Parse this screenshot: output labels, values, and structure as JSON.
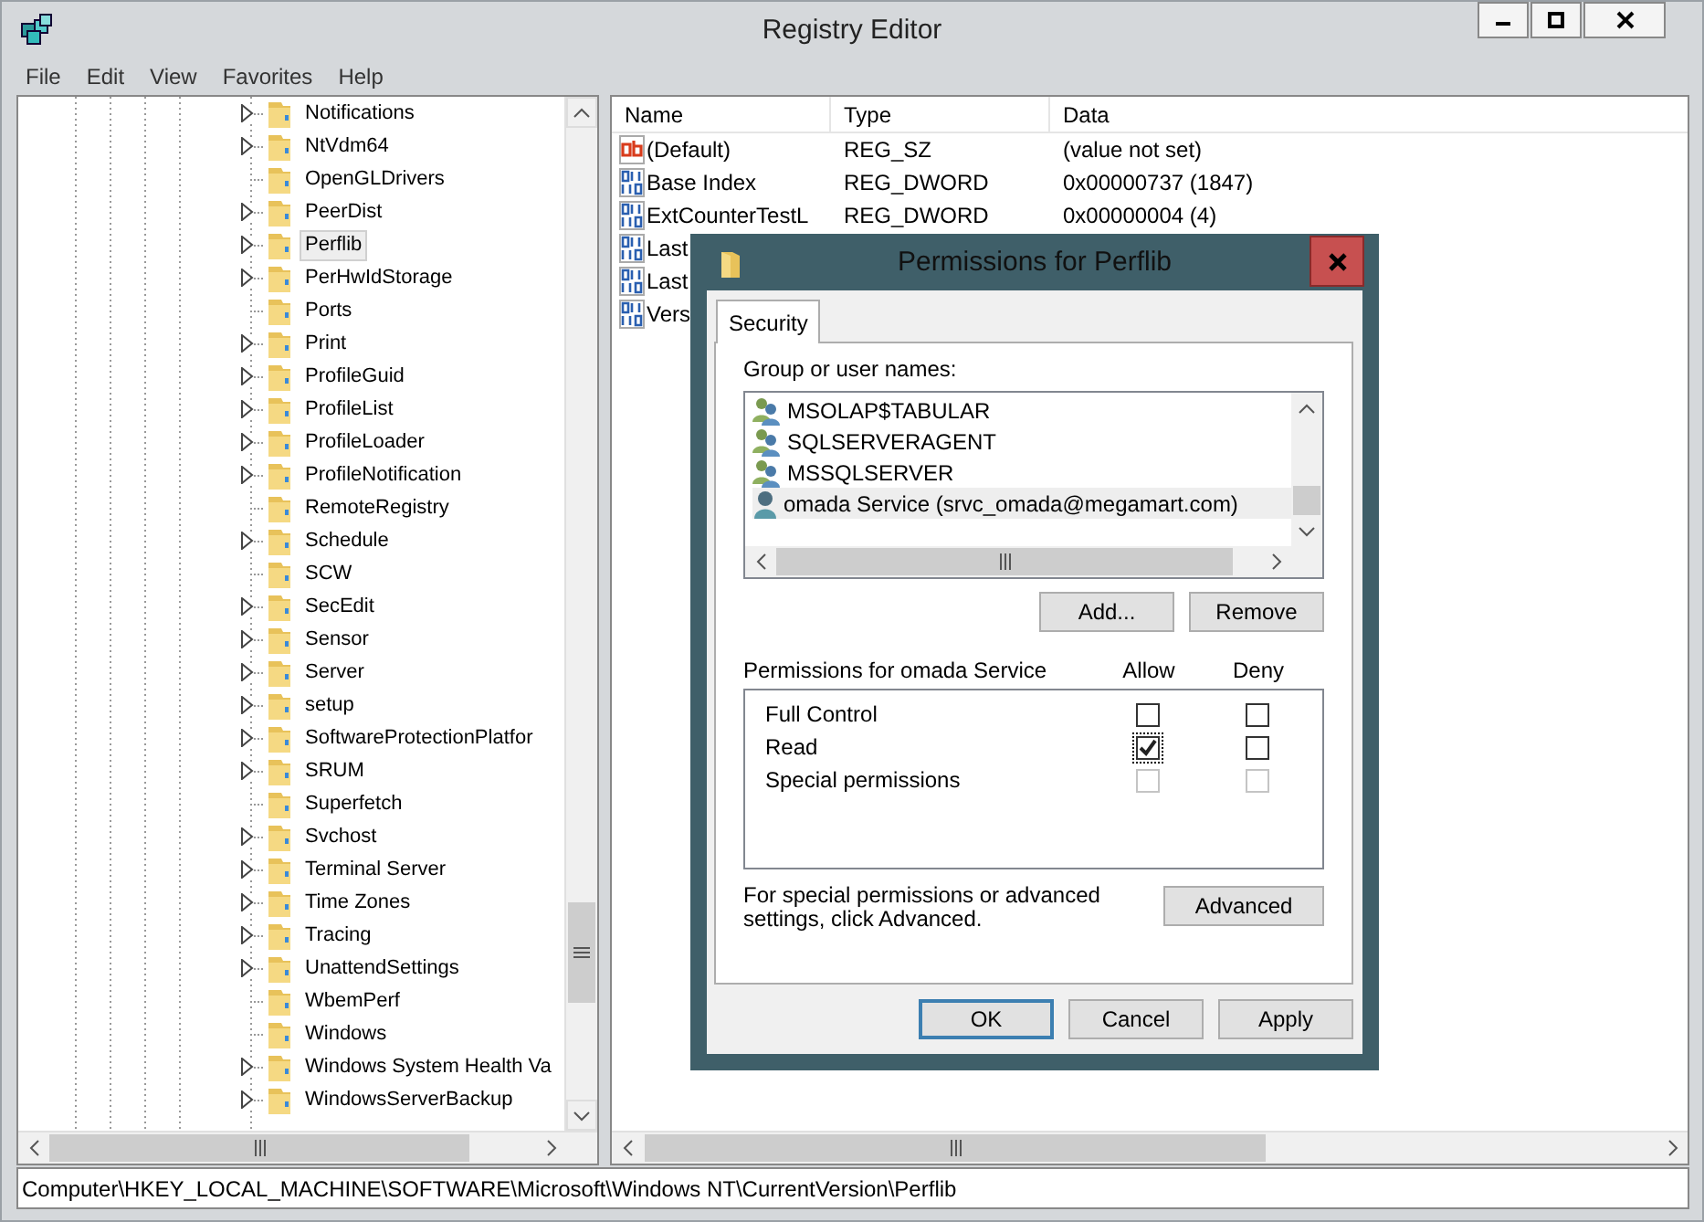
{
  "window": {
    "title": "Registry Editor"
  },
  "menu": [
    {
      "label": "File"
    },
    {
      "label": "Edit"
    },
    {
      "label": "View"
    },
    {
      "label": "Favorites"
    },
    {
      "label": "Help"
    }
  ],
  "tree": {
    "items": [
      {
        "label": "Notifications",
        "expandable": true,
        "selected": false
      },
      {
        "label": "NtVdm64",
        "expandable": true,
        "selected": false
      },
      {
        "label": "OpenGLDrivers",
        "expandable": false,
        "selected": false
      },
      {
        "label": "PeerDist",
        "expandable": true,
        "selected": false
      },
      {
        "label": "Perflib",
        "expandable": true,
        "selected": true
      },
      {
        "label": "PerHwIdStorage",
        "expandable": true,
        "selected": false
      },
      {
        "label": "Ports",
        "expandable": false,
        "selected": false
      },
      {
        "label": "Print",
        "expandable": true,
        "selected": false
      },
      {
        "label": "ProfileGuid",
        "expandable": true,
        "selected": false
      },
      {
        "label": "ProfileList",
        "expandable": true,
        "selected": false
      },
      {
        "label": "ProfileLoader",
        "expandable": true,
        "selected": false
      },
      {
        "label": "ProfileNotification",
        "expandable": true,
        "selected": false
      },
      {
        "label": "RemoteRegistry",
        "expandable": false,
        "selected": false
      },
      {
        "label": "Schedule",
        "expandable": true,
        "selected": false
      },
      {
        "label": "SCW",
        "expandable": false,
        "selected": false
      },
      {
        "label": "SecEdit",
        "expandable": true,
        "selected": false
      },
      {
        "label": "Sensor",
        "expandable": true,
        "selected": false
      },
      {
        "label": "Server",
        "expandable": true,
        "selected": false
      },
      {
        "label": "setup",
        "expandable": true,
        "selected": false
      },
      {
        "label": "SoftwareProtectionPlatfor",
        "expandable": true,
        "selected": false
      },
      {
        "label": "SRUM",
        "expandable": true,
        "selected": false
      },
      {
        "label": "Superfetch",
        "expandable": false,
        "selected": false
      },
      {
        "label": "Svchost",
        "expandable": true,
        "selected": false
      },
      {
        "label": "Terminal Server",
        "expandable": true,
        "selected": false
      },
      {
        "label": "Time Zones",
        "expandable": true,
        "selected": false
      },
      {
        "label": "Tracing",
        "expandable": true,
        "selected": false
      },
      {
        "label": "UnattendSettings",
        "expandable": true,
        "selected": false
      },
      {
        "label": "WbemPerf",
        "expandable": false,
        "selected": false
      },
      {
        "label": "Windows",
        "expandable": false,
        "selected": false
      },
      {
        "label": "Windows System Health Va",
        "expandable": true,
        "selected": false
      },
      {
        "label": "WindowsServerBackup",
        "expandable": true,
        "selected": false
      }
    ]
  },
  "values": {
    "columns": [
      "Name",
      "Type",
      "Data"
    ],
    "rows": [
      {
        "kind": "string",
        "name": "(Default)",
        "type": "REG_SZ",
        "data": "(value not set)"
      },
      {
        "kind": "binary",
        "name": "Base Index",
        "type": "REG_DWORD",
        "data": "0x00000737 (1847)"
      },
      {
        "kind": "binary",
        "name": "ExtCounterTestL",
        "type": "REG_DWORD",
        "data": "0x00000004 (4)"
      },
      {
        "kind": "binary",
        "name": "Last"
      },
      {
        "kind": "binary",
        "name": "Last"
      },
      {
        "kind": "binary",
        "name": "Vers"
      }
    ]
  },
  "dialog": {
    "title": "Permissions for Perflib",
    "tabs": [
      {
        "label": "Security",
        "selected": true
      }
    ],
    "group_label": "Group or user names:",
    "principals": [
      {
        "kind": "group",
        "name": "MSOLAP$TABULAR",
        "selected": false
      },
      {
        "kind": "group",
        "name": "SQLSERVERAGENT",
        "selected": false
      },
      {
        "kind": "group",
        "name": "MSSQLSERVER",
        "selected": false
      },
      {
        "kind": "user",
        "name": "omada Service (srvc_omada@megamart.com)",
        "selected": true
      }
    ],
    "add_button": "Add...",
    "remove_button": "Remove",
    "permissions_label": "Permissions for omada Service",
    "allow_label": "Allow",
    "deny_label": "Deny",
    "permissions": [
      {
        "label": "Full Control",
        "allow": {
          "checked": false,
          "disabled": false,
          "focused": false
        },
        "deny": {
          "checked": false,
          "disabled": false,
          "focused": false
        }
      },
      {
        "label": "Read",
        "allow": {
          "checked": true,
          "disabled": false,
          "focused": true
        },
        "deny": {
          "checked": false,
          "disabled": false,
          "focused": false
        }
      },
      {
        "label": "Special permissions",
        "allow": {
          "checked": false,
          "disabled": true,
          "focused": false
        },
        "deny": {
          "checked": false,
          "disabled": true,
          "focused": false
        }
      }
    ],
    "advanced_note": "For special permissions or advanced settings, click Advanced.",
    "advanced_button": "Advanced",
    "footer_buttons": [
      {
        "label": "OK",
        "default": true
      },
      {
        "label": "Cancel",
        "default": false
      },
      {
        "label": "Apply",
        "default": false
      }
    ]
  },
  "status_bar": {
    "path": "Computer\\HKEY_LOCAL_MACHINE\\SOFTWARE\\Microsoft\\Windows NT\\CurrentVersion\\Perflib"
  }
}
